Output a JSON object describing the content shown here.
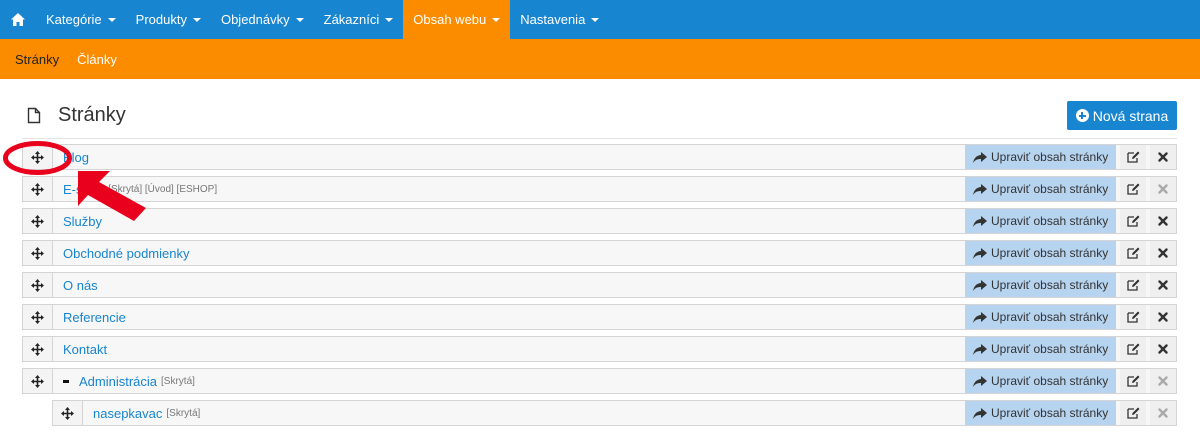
{
  "topnav": {
    "items": [
      {
        "label": "Kategórie"
      },
      {
        "label": "Produkty"
      },
      {
        "label": "Objednávky"
      },
      {
        "label": "Zákazníci"
      },
      {
        "label": "Obsah webu",
        "active": true
      },
      {
        "label": "Nastavenia"
      }
    ]
  },
  "subnav": {
    "items": [
      {
        "label": "Stránky",
        "active": true
      },
      {
        "label": "Články"
      }
    ]
  },
  "page": {
    "title": "Stránky",
    "new_button_label": "Nová strana"
  },
  "rows": [
    {
      "title": "Blog",
      "tags": "",
      "delete_enabled": true
    },
    {
      "title": "E-shop",
      "tags": "[Skrytá] [Úvod] [ESHOP]",
      "delete_enabled": false
    },
    {
      "title": "Služby",
      "tags": "",
      "delete_enabled": true
    },
    {
      "title": "Obchodné podmienky",
      "tags": "",
      "delete_enabled": true
    },
    {
      "title": "O nás",
      "tags": "",
      "delete_enabled": true
    },
    {
      "title": "Referencie",
      "tags": "",
      "delete_enabled": true
    },
    {
      "title": "Kontakt",
      "tags": "",
      "delete_enabled": true
    },
    {
      "title": "Administrácia",
      "tags": "[Skrytá]",
      "collapsed_marker": "-",
      "delete_enabled": false
    },
    {
      "title": "nasepkavac",
      "tags": "[Skrytá]",
      "child": true,
      "delete_enabled": false
    }
  ],
  "row_action_label": "Upraviť obsah stránky",
  "colors": {
    "primary": "#1785cf",
    "accent": "#fb8c00",
    "action_bg": "#b6d3ef",
    "annotation": "#e8001c"
  },
  "icons": {
    "home": "home-icon",
    "page": "page-icon",
    "move": "move-icon",
    "share": "share-arrow-icon",
    "edit": "edit-icon",
    "delete": "delete-icon"
  }
}
